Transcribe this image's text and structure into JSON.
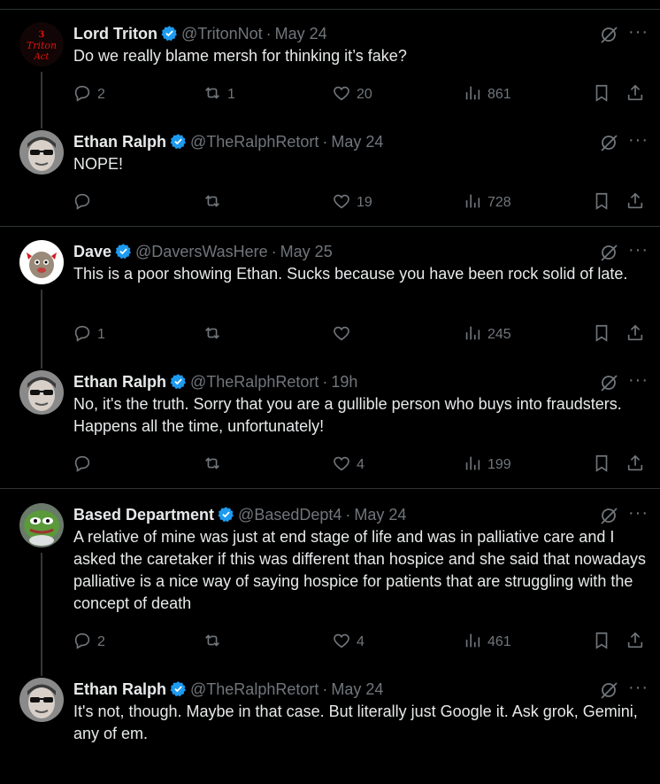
{
  "threads": [
    {
      "tweets": [
        {
          "name": "Lord Triton",
          "handle": "@TritonNot",
          "time": "May 24",
          "text": "Do we really blame mersh for thinking it’s fake?",
          "replies": "2",
          "reposts": "1",
          "likes": "20",
          "views": "861",
          "avatar": "triton"
        },
        {
          "name": "Ethan Ralph",
          "handle": "@TheRalphRetort",
          "time": "May 24",
          "text": "NOPE!",
          "replies": "",
          "reposts": "",
          "likes": "19",
          "views": "728",
          "avatar": "ralph"
        }
      ]
    },
    {
      "tweets": [
        {
          "name": "Dave",
          "handle": "@DaversWasHere",
          "time": "May 25",
          "text": "This is a poor showing Ethan. Sucks because you have been rock solid of late.",
          "replies": "1",
          "reposts": "",
          "likes": "",
          "views": "245",
          "avatar": "dave"
        },
        {
          "name": "Ethan Ralph",
          "handle": "@TheRalphRetort",
          "time": "19h",
          "text": "No, it's the truth. Sorry that you are a gullible person who buys into fraudsters. Happens all the time, unfortunately!",
          "replies": "",
          "reposts": "",
          "likes": "4",
          "views": "199",
          "avatar": "ralph"
        }
      ]
    },
    {
      "tweets": [
        {
          "name": "Based Department",
          "handle": "@BasedDept4",
          "time": "May 24",
          "text": "A relative of mine was just at end stage of life and was in palliative care and I asked the caretaker if this was different than hospice and she said that nowadays palliative is a nice way of saying hospice for patients that are struggling with the concept of death",
          "replies": "2",
          "reposts": "",
          "likes": "4",
          "views": "461",
          "avatar": "frog"
        },
        {
          "name": "Ethan Ralph",
          "handle": "@TheRalphRetort",
          "time": "May 24",
          "text": "It's not, though. Maybe in that case. But literally just Google it. Ask grok, Gemini, any of em.",
          "avatar": "ralph"
        }
      ]
    }
  ],
  "colors": {
    "verified": "#1d9bf0",
    "muted": "#71767b",
    "text": "#e7e9ea",
    "divider": "#2f3336"
  },
  "dot": "·",
  "more_glyph": "···"
}
